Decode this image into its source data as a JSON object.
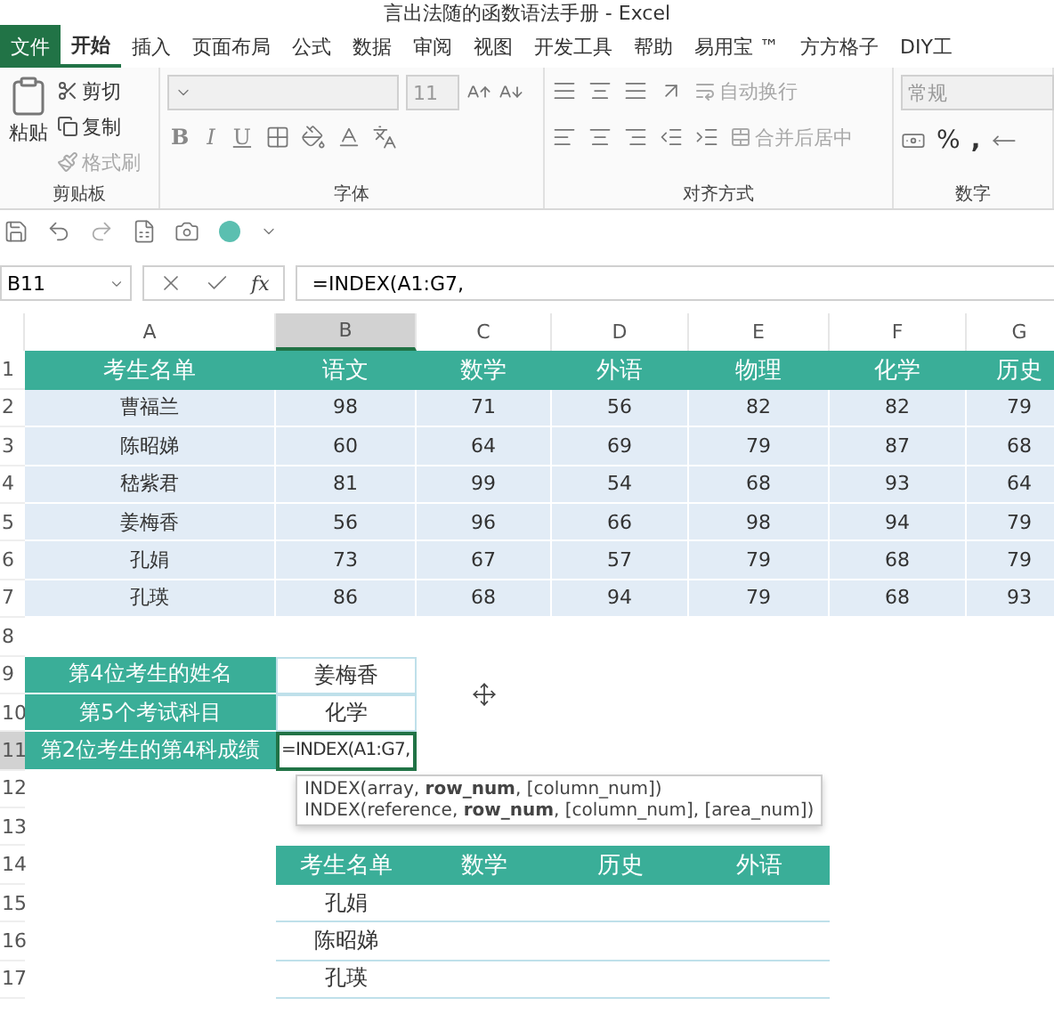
{
  "window": {
    "title": "言出法随的函数语法手册  -  Excel"
  },
  "tabs": [
    {
      "label": "文件",
      "kind": "file",
      "selected": false
    },
    {
      "label": "开始",
      "kind": "tab",
      "selected": true
    },
    {
      "label": "插入",
      "kind": "tab",
      "selected": false
    },
    {
      "label": "页面布局",
      "kind": "tab",
      "selected": false
    },
    {
      "label": "公式",
      "kind": "tab",
      "selected": false
    },
    {
      "label": "数据",
      "kind": "tab",
      "selected": false
    },
    {
      "label": "审阅",
      "kind": "tab",
      "selected": false
    },
    {
      "label": "视图",
      "kind": "tab",
      "selected": false
    },
    {
      "label": "开发工具",
      "kind": "tab",
      "selected": false
    },
    {
      "label": "帮助",
      "kind": "tab",
      "selected": false
    },
    {
      "label": "易用宝 ™",
      "kind": "tab",
      "selected": false
    },
    {
      "label": "方方格子",
      "kind": "tab",
      "selected": false
    },
    {
      "label": "DIY工",
      "kind": "tab",
      "selected": false
    }
  ],
  "ribbon": {
    "clipboard": {
      "label": "剪贴板",
      "paste": "粘贴",
      "buttons": [
        {
          "label": "剪切",
          "disabled": false
        },
        {
          "label": "复制",
          "disabled": false
        },
        {
          "label": "格式刷",
          "disabled": true
        }
      ]
    },
    "font": {
      "label": "字体",
      "size": "11",
      "bold": "B",
      "italic": "I",
      "underline": "U"
    },
    "alignment": {
      "label": "对齐方式",
      "wrap": {
        "label": "自动换行",
        "disabled": true
      },
      "merge": {
        "label": "合并后居中",
        "disabled": true
      }
    },
    "number": {
      "label": "数字",
      "format": "常规",
      "percent": "%",
      "comma": ","
    }
  },
  "formula_bar": {
    "name_box": "B11",
    "function_label": "fx",
    "formula": "=INDEX(A1:G7,"
  },
  "sheet": {
    "columns": [
      {
        "label": "A",
        "selected": false
      },
      {
        "label": "B",
        "selected": true
      },
      {
        "label": "C",
        "selected": false
      },
      {
        "label": "D",
        "selected": false
      },
      {
        "label": "E",
        "selected": false
      },
      {
        "label": "F",
        "selected": false
      },
      {
        "label": "G",
        "selected": false
      }
    ],
    "rows": [
      {
        "number": "1",
        "selected": false
      },
      {
        "number": "2",
        "selected": false
      },
      {
        "number": "3",
        "selected": false
      },
      {
        "number": "4",
        "selected": false
      },
      {
        "number": "5",
        "selected": false
      },
      {
        "number": "6",
        "selected": false
      },
      {
        "number": "7",
        "selected": false
      },
      {
        "number": "8",
        "selected": false
      },
      {
        "number": "9",
        "selected": false
      },
      {
        "number": "10",
        "selected": false
      },
      {
        "number": "11",
        "selected": true
      },
      {
        "number": "12",
        "selected": false
      },
      {
        "number": "13",
        "selected": false
      },
      {
        "number": "14",
        "selected": false
      },
      {
        "number": "15",
        "selected": false
      },
      {
        "number": "16",
        "selected": false
      },
      {
        "number": "17",
        "selected": false
      }
    ]
  },
  "scores_table": {
    "header": [
      "考生名单",
      "语文",
      "数学",
      "外语",
      "物理",
      "化学",
      "历史"
    ],
    "rows": [
      [
        "曹福兰",
        "98",
        "71",
        "56",
        "82",
        "82",
        "79"
      ],
      [
        "陈昭娣",
        "60",
        "64",
        "69",
        "79",
        "87",
        "68"
      ],
      [
        "嵇紫君",
        "81",
        "99",
        "54",
        "68",
        "93",
        "64"
      ],
      [
        "姜梅香",
        "56",
        "96",
        "66",
        "98",
        "94",
        "79"
      ],
      [
        "孔娟",
        "73",
        "67",
        "57",
        "79",
        "68",
        "79"
      ],
      [
        "孔瑛",
        "86",
        "68",
        "94",
        "79",
        "68",
        "93"
      ]
    ]
  },
  "lookup_table": {
    "rows": [
      {
        "label": "第4位考生的姓名",
        "value": "姜梅香",
        "active": false
      },
      {
        "label": "第5个考试科目",
        "value": "化学",
        "active": false
      },
      {
        "label": "第2位考生的第4科成绩",
        "value": "=INDEX(A1:G7,",
        "active": true
      }
    ]
  },
  "tooltip": {
    "lines": [
      "INDEX(array, **row_num**, [column_num])",
      "INDEX(reference, **row_num**, [column_num], [area_num])"
    ]
  },
  "result_table": {
    "header": [
      "考生名单",
      "数学",
      "历史",
      "外语"
    ],
    "names": [
      "孔娟",
      "陈昭娣",
      "孔瑛"
    ]
  }
}
